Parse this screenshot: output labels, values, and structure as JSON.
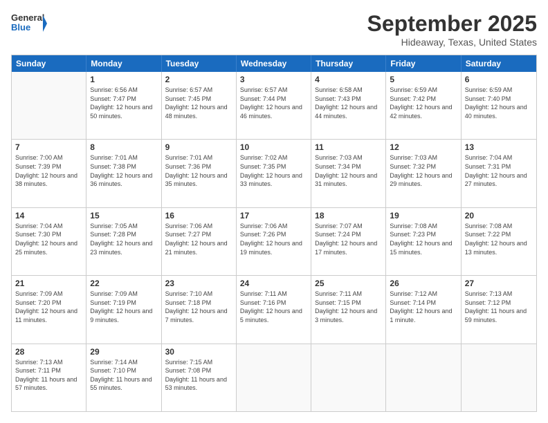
{
  "logo": {
    "line1": "General",
    "line2": "Blue"
  },
  "title": "September 2025",
  "location": "Hideaway, Texas, United States",
  "days_of_week": [
    "Sunday",
    "Monday",
    "Tuesday",
    "Wednesday",
    "Thursday",
    "Friday",
    "Saturday"
  ],
  "weeks": [
    [
      {
        "day": "",
        "sunrise": "",
        "sunset": "",
        "daylight": ""
      },
      {
        "day": "1",
        "sunrise": "6:56 AM",
        "sunset": "7:47 PM",
        "daylight": "12 hours and 50 minutes."
      },
      {
        "day": "2",
        "sunrise": "6:57 AM",
        "sunset": "7:45 PM",
        "daylight": "12 hours and 48 minutes."
      },
      {
        "day": "3",
        "sunrise": "6:57 AM",
        "sunset": "7:44 PM",
        "daylight": "12 hours and 46 minutes."
      },
      {
        "day": "4",
        "sunrise": "6:58 AM",
        "sunset": "7:43 PM",
        "daylight": "12 hours and 44 minutes."
      },
      {
        "day": "5",
        "sunrise": "6:59 AM",
        "sunset": "7:42 PM",
        "daylight": "12 hours and 42 minutes."
      },
      {
        "day": "6",
        "sunrise": "6:59 AM",
        "sunset": "7:40 PM",
        "daylight": "12 hours and 40 minutes."
      }
    ],
    [
      {
        "day": "7",
        "sunrise": "7:00 AM",
        "sunset": "7:39 PM",
        "daylight": "12 hours and 38 minutes."
      },
      {
        "day": "8",
        "sunrise": "7:01 AM",
        "sunset": "7:38 PM",
        "daylight": "12 hours and 36 minutes."
      },
      {
        "day": "9",
        "sunrise": "7:01 AM",
        "sunset": "7:36 PM",
        "daylight": "12 hours and 35 minutes."
      },
      {
        "day": "10",
        "sunrise": "7:02 AM",
        "sunset": "7:35 PM",
        "daylight": "12 hours and 33 minutes."
      },
      {
        "day": "11",
        "sunrise": "7:03 AM",
        "sunset": "7:34 PM",
        "daylight": "12 hours and 31 minutes."
      },
      {
        "day": "12",
        "sunrise": "7:03 AM",
        "sunset": "7:32 PM",
        "daylight": "12 hours and 29 minutes."
      },
      {
        "day": "13",
        "sunrise": "7:04 AM",
        "sunset": "7:31 PM",
        "daylight": "12 hours and 27 minutes."
      }
    ],
    [
      {
        "day": "14",
        "sunrise": "7:04 AM",
        "sunset": "7:30 PM",
        "daylight": "12 hours and 25 minutes."
      },
      {
        "day": "15",
        "sunrise": "7:05 AM",
        "sunset": "7:28 PM",
        "daylight": "12 hours and 23 minutes."
      },
      {
        "day": "16",
        "sunrise": "7:06 AM",
        "sunset": "7:27 PM",
        "daylight": "12 hours and 21 minutes."
      },
      {
        "day": "17",
        "sunrise": "7:06 AM",
        "sunset": "7:26 PM",
        "daylight": "12 hours and 19 minutes."
      },
      {
        "day": "18",
        "sunrise": "7:07 AM",
        "sunset": "7:24 PM",
        "daylight": "12 hours and 17 minutes."
      },
      {
        "day": "19",
        "sunrise": "7:08 AM",
        "sunset": "7:23 PM",
        "daylight": "12 hours and 15 minutes."
      },
      {
        "day": "20",
        "sunrise": "7:08 AM",
        "sunset": "7:22 PM",
        "daylight": "12 hours and 13 minutes."
      }
    ],
    [
      {
        "day": "21",
        "sunrise": "7:09 AM",
        "sunset": "7:20 PM",
        "daylight": "12 hours and 11 minutes."
      },
      {
        "day": "22",
        "sunrise": "7:09 AM",
        "sunset": "7:19 PM",
        "daylight": "12 hours and 9 minutes."
      },
      {
        "day": "23",
        "sunrise": "7:10 AM",
        "sunset": "7:18 PM",
        "daylight": "12 hours and 7 minutes."
      },
      {
        "day": "24",
        "sunrise": "7:11 AM",
        "sunset": "7:16 PM",
        "daylight": "12 hours and 5 minutes."
      },
      {
        "day": "25",
        "sunrise": "7:11 AM",
        "sunset": "7:15 PM",
        "daylight": "12 hours and 3 minutes."
      },
      {
        "day": "26",
        "sunrise": "7:12 AM",
        "sunset": "7:14 PM",
        "daylight": "12 hours and 1 minute."
      },
      {
        "day": "27",
        "sunrise": "7:13 AM",
        "sunset": "7:12 PM",
        "daylight": "11 hours and 59 minutes."
      }
    ],
    [
      {
        "day": "28",
        "sunrise": "7:13 AM",
        "sunset": "7:11 PM",
        "daylight": "11 hours and 57 minutes."
      },
      {
        "day": "29",
        "sunrise": "7:14 AM",
        "sunset": "7:10 PM",
        "daylight": "11 hours and 55 minutes."
      },
      {
        "day": "30",
        "sunrise": "7:15 AM",
        "sunset": "7:08 PM",
        "daylight": "11 hours and 53 minutes."
      },
      {
        "day": "",
        "sunrise": "",
        "sunset": "",
        "daylight": ""
      },
      {
        "day": "",
        "sunrise": "",
        "sunset": "",
        "daylight": ""
      },
      {
        "day": "",
        "sunrise": "",
        "sunset": "",
        "daylight": ""
      },
      {
        "day": "",
        "sunrise": "",
        "sunset": "",
        "daylight": ""
      }
    ]
  ]
}
